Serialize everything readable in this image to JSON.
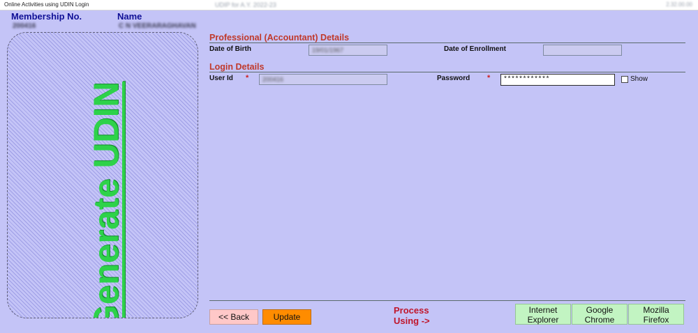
{
  "window": {
    "title": "Online Activities using UDIN Login",
    "caption": "UDIP for A.Y. 2022-23",
    "corner": "2.32.00.00"
  },
  "header": {
    "membership_label": "Membership No.",
    "membership_value": "200416",
    "name_label": "Name",
    "name_value": "C N VEERARAGHAVAN"
  },
  "left_panel": {
    "text": "Generate UDIN"
  },
  "professional": {
    "title": "Professional (Accountant) Details",
    "dob_label": "Date of Birth",
    "dob_value": "19/01/1967",
    "enroll_label": "Date of Enrollment",
    "enroll_value": ""
  },
  "login": {
    "title": "Login Details",
    "userid_label": "User Id",
    "userid_value": "200416",
    "required_mark": "*",
    "password_label": "Password",
    "password_value": "************",
    "show_label": "Show"
  },
  "actions": {
    "back": "<< Back",
    "update": "Update",
    "process_line1": "Process",
    "process_line2": "Using ->"
  },
  "browsers": [
    {
      "line1": "Internet",
      "line2": "Explorer"
    },
    {
      "line1": "Google",
      "line2": "Chrome"
    },
    {
      "line1": "Mozilla",
      "line2": "Firefox"
    }
  ]
}
